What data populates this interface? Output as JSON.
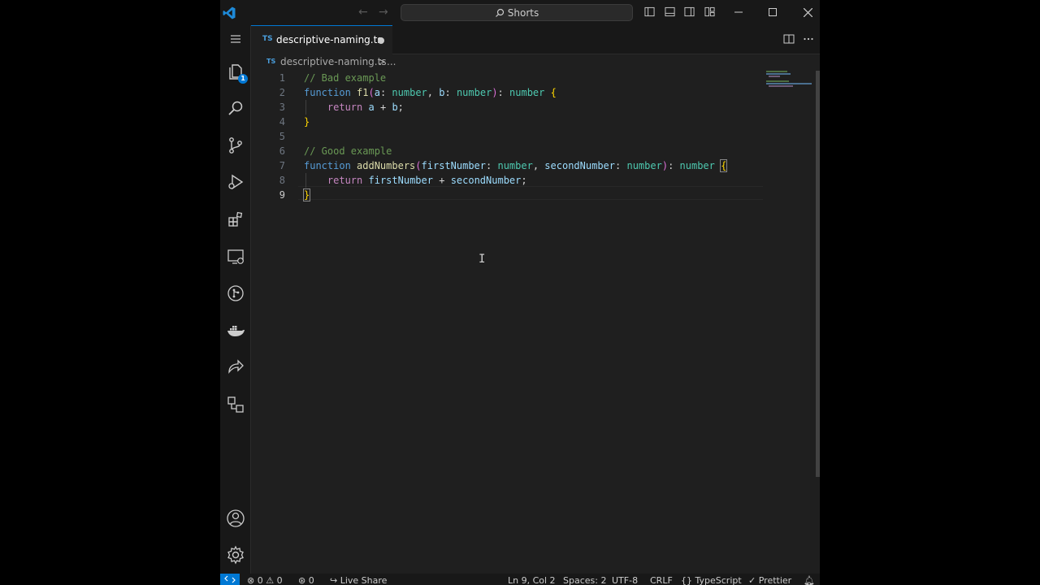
{
  "titlebar": {
    "search_label": "Shorts"
  },
  "activity": {
    "explorer_badge": "1"
  },
  "tab": {
    "lang": "TS",
    "filename": "descriptive-naming.ts"
  },
  "breadcrumb": {
    "lang": "TS",
    "file": "descriptive-naming.ts",
    "separator": ">",
    "more": "..."
  },
  "editor": {
    "line_numbers": [
      "1",
      "2",
      "3",
      "4",
      "5",
      "6",
      "7",
      "8",
      "9"
    ],
    "lines": [
      "// Bad example",
      "function f1(a: number, b: number): number {",
      "    return a + b;",
      "}",
      "",
      "// Good example",
      "function addNumbers(firstNumber: number, secondNumber: number): number {",
      "    return firstNumber + secondNumber;",
      "}"
    ]
  },
  "statusbar": {
    "errors": "0",
    "warnings": "0",
    "ports": "0",
    "live_share": "Live Share",
    "position": "Ln 9, Col 2",
    "spaces": "Spaces: 2",
    "encoding": "UTF-8",
    "eol": "CRLF",
    "language": "TypeScript",
    "formatter": "Prettier"
  },
  "colors": {
    "accent": "#0078d4",
    "editor_bg": "#1f1f1f",
    "chrome_bg": "#181818"
  }
}
